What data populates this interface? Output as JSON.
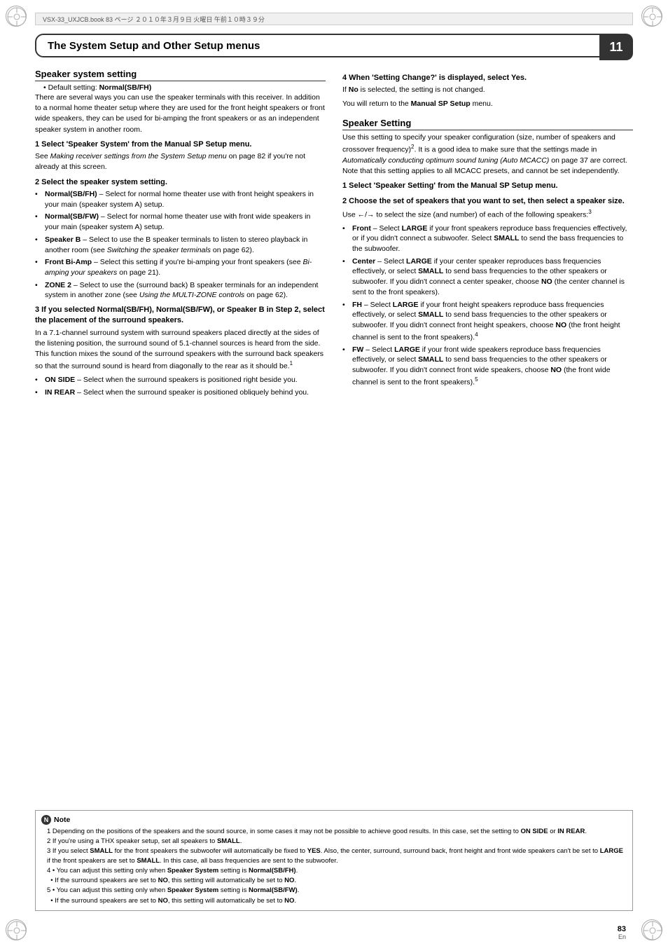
{
  "header": {
    "text": "VSX-33_UXJCB.book  83 ページ  ２０１０年３月９日  火曜日  午前１０時３９分"
  },
  "title": "The System Setup and Other Setup menus",
  "chapter_number": "11",
  "page_number": "83",
  "page_lang": "En",
  "left_column": {
    "section1": {
      "title": "Speaker system setting",
      "default_bullet": "Default setting: Normal(SB/FH)",
      "intro": "There are several ways you can use the speaker terminals with this receiver. In addition to a normal home theater setup where they are used for the front height speakers or front wide speakers, they can be used for bi-amping the front speakers or as an independent speaker system in another room.",
      "step1_heading": "1   Select 'Speaker System' from the Manual SP Setup menu.",
      "step1_text": "See Making receiver settings from the System Setup menu on page 82 if you're not already at this screen.",
      "step2_heading": "2   Select the speaker system setting.",
      "bullets": [
        {
          "label": "Normal(SB/FH)",
          "text": " – Select for normal home theater use with front height speakers in your main (speaker system A) setup."
        },
        {
          "label": "Normal(SB/FW)",
          "text": " – Select for normal home theater use with front wide speakers in your main (speaker system A) setup."
        },
        {
          "label": "Speaker B",
          "text": " – Select to use the B speaker terminals to listen to stereo playback in another room (see Switching the speaker terminals on page 62)."
        },
        {
          "label": "Front Bi-Amp",
          "text": " – Select this setting if you're bi-amping your front speakers (see Bi-amping your speakers on page 21)."
        },
        {
          "label": "ZONE 2",
          "text": " – Select to use the (surround back) B speaker terminals for an independent system in another zone (see Using the MULTI-ZONE controls on page 62)."
        }
      ],
      "step3_heading": "3   If you selected Normal(SB/FH), Normal(SB/FW), or Speaker B in Step 2, select the placement of the surround speakers.",
      "step3_text": "In a 7.1-channel surround system with surround speakers placed directly at the sides of the listening position, the surround sound of 5.1-channel sources is heard from the side. This function mixes the sound of the surround speakers with the surround back speakers so that the surround sound is heard from diagonally to the rear as it should be.",
      "step3_footnote": "1",
      "placement_bullets": [
        {
          "label": "ON SIDE",
          "text": " – Select when the surround speakers is positioned right beside you."
        },
        {
          "label": "IN REAR",
          "text": " – Select when the surround speaker is positioned obliquely behind you."
        }
      ],
      "step4_heading": "4   When 'Setting Change?' is displayed, select Yes.",
      "step4_text1": "If No is selected, the setting is not changed.",
      "step4_text2": "You will return to the Manual SP Setup menu."
    }
  },
  "right_column": {
    "section2": {
      "title": "Speaker Setting",
      "intro": "Use this setting to specify your speaker configuration (size, number of speakers and crossover frequency)",
      "intro_sup": "2",
      "intro2": ". It is a good idea to make sure that the settings made in Automatically conducting optimum sound tuning (Auto MCACC) on page 37 are correct. Note that this setting applies to all MCACC presets, and cannot be set independently.",
      "step1_heading": "1   Select 'Speaker Setting' from the Manual SP Setup menu.",
      "step2_heading": "2   Choose the set of speakers that you want to set, then select a speaker size.",
      "step2_text": "Use ←/→ to select the size (and number) of each of the following speakers:",
      "step2_sup": "3",
      "speaker_bullets": [
        {
          "label": "Front",
          "text": " – Select LARGE if your front speakers reproduce bass frequencies effectively, or if you didn't connect a subwoofer. Select SMALL to send the bass frequencies to the subwoofer."
        },
        {
          "label": "Center",
          "text": " – Select LARGE if your center speaker reproduces bass frequencies effectively, or select SMALL to send bass frequencies to the other speakers or subwoofer. If you didn't connect a center speaker, choose NO (the center channel is sent to the front speakers)."
        },
        {
          "label": "FH",
          "text": " – Select LARGE if your front height speakers reproduce bass frequencies effectively, or select SMALL to send bass frequencies to the other speakers or subwoofer. If you didn't connect front height speakers, choose NO (the front height channel is sent to the front speakers).",
          "sup": "4"
        },
        {
          "label": "FW",
          "text": " – Select LARGE if your front wide speakers reproduce bass frequencies effectively, or select SMALL to send bass frequencies to the other speakers or subwoofer. If you didn't connect front wide speakers, choose NO (the front wide channel is sent to the front speakers).",
          "sup": "5"
        }
      ]
    }
  },
  "notes": {
    "label": "Note",
    "items": [
      "1 Depending on the positions of the speakers and the sound source, in some cases it may not be possible to achieve good results. In this case, set the setting to ON SIDE or IN REAR.",
      "2 If you're using a THX speaker setup, set all speakers to SMALL.",
      "3 If you select SMALL for the front speakers the subwoofer will automatically be fixed to YES. Also, the center, surround, surround back, front height and front wide speakers can't be set to LARGE if the front speakers are set to SMALL. In this case, all bass frequencies are sent to the subwoofer.",
      "4 • You can adjust this setting only when Speaker System setting is Normal(SB/FH).",
      "4b• If the surround speakers are set to NO, this setting will automatically be set to NO.",
      "5 • You can adjust this setting only when Speaker System setting is Normal(SB/FW).",
      "5b• If the surround speakers are set to NO, this setting will automatically be set to NO."
    ]
  }
}
